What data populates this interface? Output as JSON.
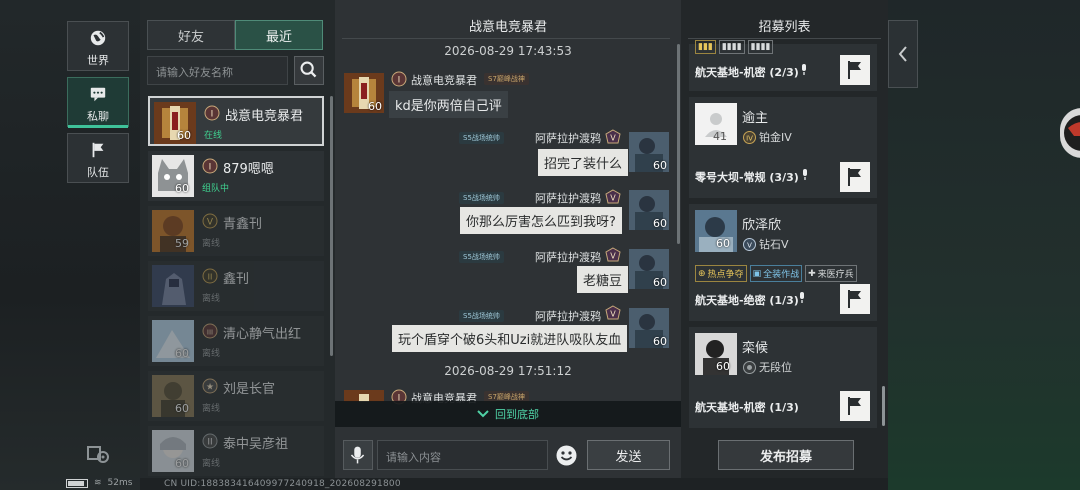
{
  "nav": [
    {
      "label": "世界",
      "icon": "globe-icon"
    },
    {
      "label": "私聊",
      "icon": "chat-bubble-icon"
    },
    {
      "label": "队伍",
      "icon": "flag-icon"
    }
  ],
  "status_bar": {
    "latency": "52ms",
    "uid": "CN UID:1883834164099772409​18_20260829​1800"
  },
  "friends_panel": {
    "tabs": [
      "好友",
      "最近"
    ],
    "active_tab": "最近",
    "search_placeholder": "请输入好友名称",
    "friends": [
      {
        "name": "战意电竞暴君",
        "level": "60",
        "status": "在线",
        "status_color": "#3fd08f"
      },
      {
        "name": "879嗯嗯",
        "level": "60",
        "status": "组队中",
        "status_color": "#3fd08f"
      },
      {
        "name": "青鑫刊",
        "level": "59",
        "status": "离线",
        "status_color": "#9a9fa1"
      },
      {
        "name": "鑫刊",
        "level": "",
        "status": "离线",
        "status_color": "#9a9fa1"
      },
      {
        "name": "清心静气出红",
        "level": "60",
        "status": "离线",
        "status_color": "#9a9fa1"
      },
      {
        "name": "刘是长官",
        "level": "60",
        "status": "离线",
        "status_color": "#9a9fa1"
      },
      {
        "name": "泰中吴彦祖",
        "level": "60",
        "status": "离线",
        "status_color": "#9a9fa1"
      }
    ]
  },
  "chat": {
    "title": "战意电竞暴君",
    "timestamp1": "2026-08-29 17:43:53",
    "timestamp2": "2026-08-29 17:51:12",
    "peer_name": "战意电竞暴君",
    "peer_tag": "S7巅峰战神",
    "peer_level": "60",
    "self_name": "阿萨拉护渡鸦",
    "self_tag": "S5战场统帅",
    "self_level": "60",
    "messages": [
      {
        "from": "peer",
        "text": "kd是你两倍自己评"
      },
      {
        "from": "self",
        "text": "招完了装什么"
      },
      {
        "from": "self",
        "text": "你那么厉害怎么匹到我呀?"
      },
      {
        "from": "self",
        "text": "老糖豆"
      },
      {
        "from": "self",
        "text": "玩个盾穿个破6头和Uzi就进队吸队友血"
      }
    ],
    "back_to_bottom": "回到底部",
    "input_placeholder": "请输入内容",
    "send_label": "发送"
  },
  "recruit": {
    "title": "招募列表",
    "cards": [
      {
        "mode": "航天基地-机密 (2/3)"
      },
      {
        "name": "逾主",
        "level": "41",
        "rank": "铂金IV",
        "mode": "零号大坝-常规 (3/3)"
      },
      {
        "name": "欣泽欣",
        "level": "60",
        "rank": "钻石V",
        "chips": [
          "热点争夺",
          "全装作战",
          "来医疗兵"
        ],
        "mode": "航天基地-绝密 (1/3)"
      },
      {
        "name": "栾候",
        "level": "60",
        "rank": "无段位",
        "mode": "航天基地-机密 (1/3)"
      }
    ],
    "publish_label": "发布招募"
  }
}
